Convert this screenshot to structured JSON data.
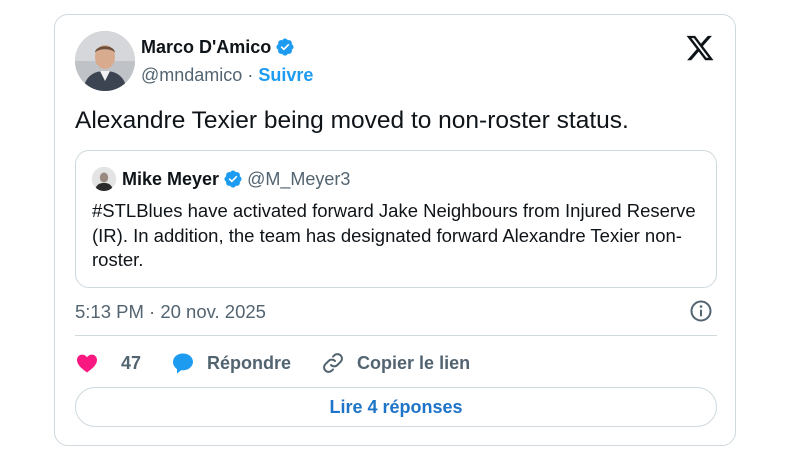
{
  "author": {
    "name": "Marco D'Amico",
    "handle": "@mndamico",
    "separator": "·",
    "follow_label": "Suivre"
  },
  "tweet": {
    "text": "Alexandre Texier being moved to non-roster status."
  },
  "quoted": {
    "name": "Mike Meyer",
    "handle": "@M_Meyer3",
    "text": "#STLBlues have activated forward Jake Neighbours from Injured Reserve (IR).  In addition, the team has designated forward Alexandre Texier non-roster."
  },
  "meta": {
    "timestamp": "5:13 PM · 20 nov. 2025"
  },
  "actions": {
    "like_count": "47",
    "reply_label": "Répondre",
    "copy_link_label": "Copier le lien"
  },
  "read_replies_label": "Lire 4 réponses",
  "icons": {
    "brand": "x-logo-icon",
    "verified": "verified-badge-icon",
    "like": "heart-icon",
    "reply": "speech-bubble-icon",
    "copy": "link-icon",
    "info": "info-icon"
  },
  "colors": {
    "accent": "#1d9bf0",
    "like": "#f91880",
    "muted": "#536471",
    "border": "#cfd9de",
    "replies_link": "#1d74c8"
  }
}
